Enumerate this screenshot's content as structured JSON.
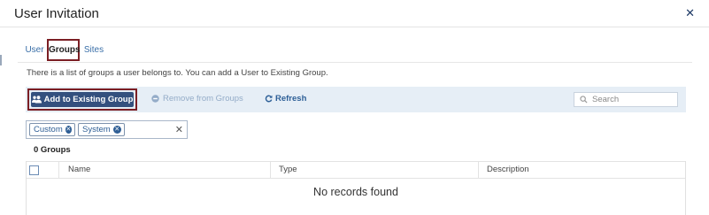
{
  "modal": {
    "title": "User Invitation",
    "close_icon": "close-icon"
  },
  "tabs": [
    {
      "label": "User",
      "active": false
    },
    {
      "label": "Groups",
      "active": true
    },
    {
      "label": "Sites",
      "active": false
    }
  ],
  "help_text": "There is a list of groups a user belongs to. You can add a User to Existing Group.",
  "toolbar": {
    "add_label": "Add to Existing Group",
    "add_icon": "users-icon",
    "remove_label": "Remove from Groups",
    "remove_icon": "minus-circle-icon",
    "refresh_label": "Refresh",
    "refresh_icon": "refresh-icon",
    "search_placeholder": "Search",
    "search_icon": "search-icon"
  },
  "filters": {
    "chips": [
      "Custom",
      "System"
    ],
    "clear_icon": "close-icon"
  },
  "count_label": "0 Groups",
  "table": {
    "columns": [
      "Name",
      "Type",
      "Description"
    ],
    "empty_message": "No records found"
  },
  "colors": {
    "accent": "#34507e",
    "highlight_border": "#7b1e24",
    "toolbar_bg": "#e6eef6",
    "link": "#2d5f97"
  }
}
